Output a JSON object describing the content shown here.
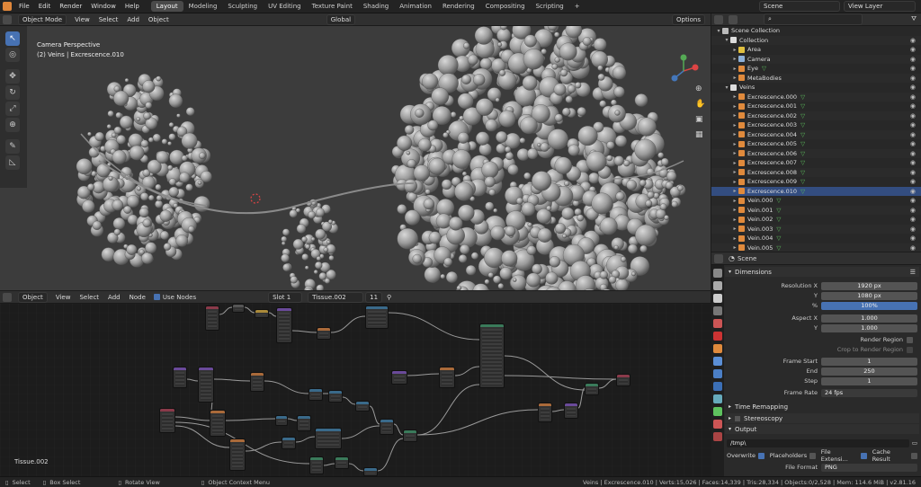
{
  "topbar": {
    "menus": [
      "File",
      "Edit",
      "Render",
      "Window",
      "Help"
    ],
    "workspaces": [
      "Layout",
      "Modeling",
      "Sculpting",
      "UV Editing",
      "Texture Paint",
      "Shading",
      "Animation",
      "Rendering",
      "Compositing",
      "Scripting"
    ],
    "active_workspace": "Layout",
    "add_tab": "+",
    "scene": "Scene",
    "view_layer": "View Layer"
  },
  "viewport": {
    "mode": "Object Mode",
    "menus": [
      "View",
      "Select",
      "Add",
      "Object"
    ],
    "orientation": "Global",
    "options": "Options",
    "info_line1": "Camera Perspective",
    "info_line2": "(2) Veins | Excrescence.010"
  },
  "node_editor": {
    "editor_type": "Object",
    "menus": [
      "View",
      "Select",
      "Add",
      "Node"
    ],
    "use_nodes": "Use Nodes",
    "slot": "Slot 1",
    "material": "Tissue.002",
    "users": "11",
    "corner_label": "Tissue.002"
  },
  "outliner": {
    "search_placeholder": "",
    "rows": [
      {
        "label": "Scene Collection",
        "level": 0,
        "type": "scene"
      },
      {
        "label": "Collection",
        "level": 1,
        "type": "coll"
      },
      {
        "label": "Area",
        "level": 2,
        "type": "light"
      },
      {
        "label": "Camera",
        "level": 2,
        "type": "cam"
      },
      {
        "label": "Eye",
        "level": 2,
        "type": "mesh"
      },
      {
        "label": "MetaBodies",
        "level": 2,
        "type": "meta"
      },
      {
        "label": "Veins",
        "level": 1,
        "type": "coll"
      },
      {
        "label": "Excrescence.000",
        "level": 2,
        "type": "mesh"
      },
      {
        "label": "Excrescence.001",
        "level": 2,
        "type": "mesh"
      },
      {
        "label": "Excrescence.002",
        "level": 2,
        "type": "mesh"
      },
      {
        "label": "Excrescence.003",
        "level": 2,
        "type": "mesh"
      },
      {
        "label": "Excrescence.004",
        "level": 2,
        "type": "mesh"
      },
      {
        "label": "Excrescence.005",
        "level": 2,
        "type": "mesh"
      },
      {
        "label": "Excrescence.006",
        "level": 2,
        "type": "mesh"
      },
      {
        "label": "Excrescence.007",
        "level": 2,
        "type": "mesh"
      },
      {
        "label": "Excrescence.008",
        "level": 2,
        "type": "mesh"
      },
      {
        "label": "Excrescence.009",
        "level": 2,
        "type": "mesh"
      },
      {
        "label": "Excrescence.010",
        "level": 2,
        "type": "mesh"
      },
      {
        "label": "Vein.000",
        "level": 2,
        "type": "curve"
      },
      {
        "label": "Vein.001",
        "level": 2,
        "type": "curve"
      },
      {
        "label": "Vein.002",
        "level": 2,
        "type": "curve"
      },
      {
        "label": "Vein.003",
        "level": 2,
        "type": "curve"
      },
      {
        "label": "Vein.004",
        "level": 2,
        "type": "curve"
      },
      {
        "label": "Vein.005",
        "level": 2,
        "type": "curve"
      }
    ]
  },
  "properties": {
    "context": "Scene",
    "dimensions": "Dimensions",
    "res_x_label": "Resolution X",
    "res_x": "1920 px",
    "res_y_label": "Y",
    "res_y": "1080 px",
    "pct_label": "%",
    "pct": "100%",
    "aspect_x_label": "Aspect X",
    "aspect_x": "1.000",
    "aspect_y_label": "Y",
    "aspect_y": "1.000",
    "render_region": "Render Region",
    "crop_region": "Crop to Render Region",
    "frame_start_label": "Frame Start",
    "frame_start": "1",
    "end_label": "End",
    "end": "250",
    "step_label": "Step",
    "step": "1",
    "frame_rate_label": "Frame Rate",
    "frame_rate": "24 fps",
    "time_remapping": "Time Remapping",
    "stereoscopy": "Stereoscopy",
    "output": "Output",
    "output_path": "/tmp\\",
    "overwrite": "Overwrite",
    "placeholders": "Placeholders",
    "file_extensions": "File Extensi...",
    "cache_result": "Cache Result",
    "file_format_label": "File Format",
    "file_format": "PNG"
  },
  "statusbar": {
    "select": "Select",
    "box_select": "Box Select",
    "rotate": "Rotate View",
    "context_menu": "Object Context Menu",
    "stats": "Veins | Excrescence.010 | Verts:15,026 | Faces:14,339 | Tris:28,334 | Objects:0/2,528 | Mem: 114.6 MiB | v2.81.16"
  },
  "colors": {
    "accent": "#4772b3",
    "mesh_icon": "#e08a3c",
    "collection_icon": "#ddd",
    "green_tri": "#5ec25e"
  }
}
